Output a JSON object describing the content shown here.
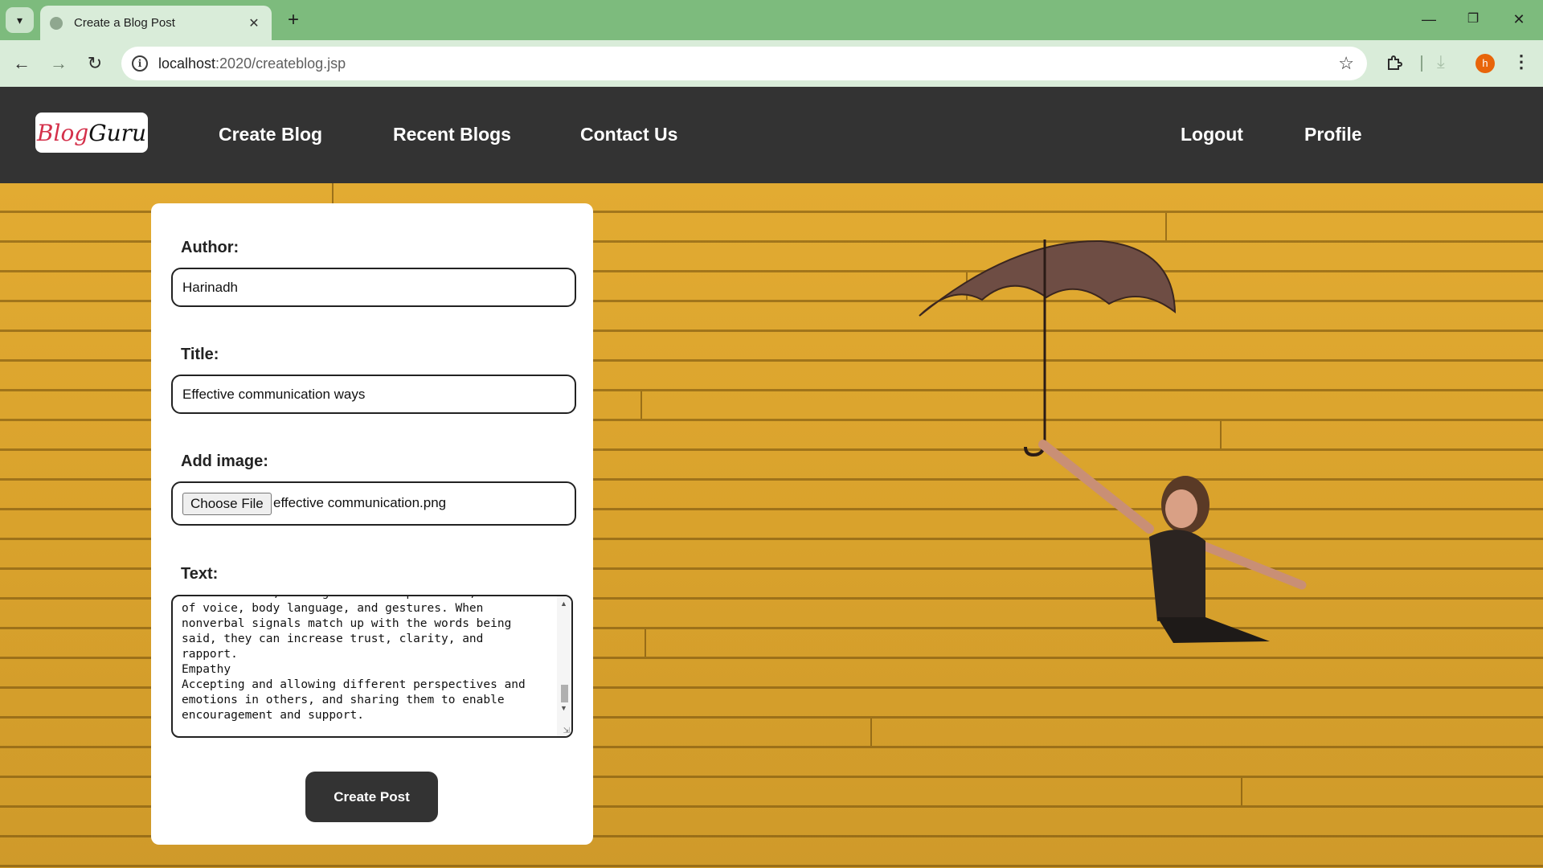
{
  "browser": {
    "tab_title": "Create a Blog Post",
    "url_host": "localhost",
    "url_path": ":2020/createblog.jsp",
    "profile_initial": "h"
  },
  "site": {
    "logo_text_a": "Blog",
    "logo_text_b": "Guru",
    "nav": {
      "create_blog": "Create Blog",
      "recent_blogs": "Recent Blogs",
      "contact_us": "Contact Us",
      "logout": "Logout",
      "profile": "Profile"
    }
  },
  "form": {
    "author_label": "Author:",
    "author_value": "Harinadh",
    "title_label": "Title:",
    "title_value": "Effective communication ways",
    "image_label": "Add image:",
    "choose_file": "Choose File",
    "file_name": "effective communication.png",
    "text_label": "Text:",
    "text_value": "written words, through facial expressions, tone\nof voice, body language, and gestures. When\nnonverbal signals match up with the words being\nsaid, they can increase trust, clarity, and\nrapport.\nEmpathy\nAccepting and allowing different perspectives and\nemotions in others, and sharing them to enable\nencouragement and support.",
    "submit_label": "Create Post"
  },
  "colors": {
    "browser_frame": "#7dbb7d",
    "site_nav": "#333333",
    "wall": "#e2ab32",
    "button": "#333333"
  }
}
